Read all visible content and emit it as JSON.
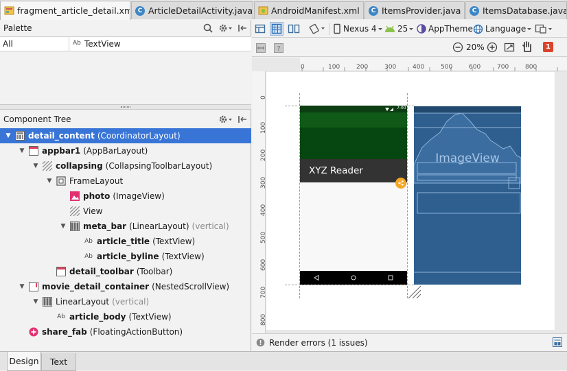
{
  "tabs": [
    {
      "label": "fragment_article_detail.xml",
      "icon": "xml-layout-icon",
      "active": true
    },
    {
      "label": "ArticleDetailActivity.java",
      "icon": "java-class-icon"
    },
    {
      "label": "AndroidManifest.xml",
      "icon": "android-manifest-icon"
    },
    {
      "label": "ItemsProvider.java",
      "icon": "java-class-icon"
    },
    {
      "label": "ItemsDatabase.java",
      "icon": "java-class-icon"
    }
  ],
  "class_badge": "C",
  "close_glyph": "×",
  "palette": {
    "title": "Palette",
    "filter_label": "All",
    "item_icon_text": "Ab",
    "item_label": "TextView"
  },
  "component_tree": {
    "title": "Component Tree",
    "rows": [
      {
        "name": "detail_content",
        "type": "(CoordinatorLayout)",
        "depth": 0,
        "expanded": true,
        "selected": true,
        "icon": "coordinator-layout-icon"
      },
      {
        "name": "appbar1",
        "type": "(AppBarLayout)",
        "depth": 1,
        "expanded": true,
        "icon": "appbar-layout-icon"
      },
      {
        "name": "collapsing",
        "type": "(CollapsingToolbarLayout)",
        "depth": 2,
        "expanded": true,
        "icon": "collapsing-toolbar-icon"
      },
      {
        "name": "FrameLayout",
        "type": "",
        "depth": 3,
        "expanded": true,
        "plain": true,
        "icon": "frame-layout-icon"
      },
      {
        "name": "photo",
        "type": "(ImageView)",
        "depth": 4,
        "icon": "image-view-icon"
      },
      {
        "name": "View",
        "type": "",
        "depth": 4,
        "plain": true,
        "icon": "view-icon"
      },
      {
        "name": "meta_bar",
        "type": "(LinearLayout)",
        "extra": "(vertical)",
        "depth": 4,
        "expanded": true,
        "icon": "linear-layout-icon"
      },
      {
        "name": "article_title",
        "type": "(TextView)",
        "depth": 5,
        "icon": "text-view-icon"
      },
      {
        "name": "article_byline",
        "type": "(TextView)",
        "depth": 5,
        "icon": "text-view-icon"
      },
      {
        "name": "detail_toolbar",
        "type": "(Toolbar)",
        "depth": 3,
        "icon": "toolbar-icon"
      },
      {
        "name": "movie_detail_container",
        "type": "(NestedScrollView)",
        "depth": 1,
        "expanded": true,
        "icon": "scroll-view-icon"
      },
      {
        "name": "LinearLayout",
        "type": "",
        "extra": "(vertical)",
        "depth": 2,
        "expanded": true,
        "plain": true,
        "icon": "linear-layout-icon"
      },
      {
        "name": "article_body",
        "type": "(TextView)",
        "depth": 3,
        "icon": "text-view-icon"
      },
      {
        "name": "share_fab",
        "type": "(FloatingActionButton)",
        "depth": 1,
        "icon": "fab-icon"
      }
    ]
  },
  "designer_toolbar": {
    "device": "Nexus 4",
    "api": "25",
    "theme": "AppTheme",
    "language": "Language",
    "zoom": "20%"
  },
  "ruler": {
    "top": [
      "0",
      "100",
      "200",
      "300",
      "400",
      "500",
      "600",
      "700",
      "800"
    ],
    "left": [
      "0",
      "100",
      "200",
      "300",
      "400",
      "500",
      "600",
      "700",
      "800"
    ]
  },
  "preview": {
    "app_title": "XYZ Reader",
    "status_time": "7:00",
    "blueprint_label": "ImageView"
  },
  "status": {
    "text": "Render errors (1 issues)",
    "error_count": "1"
  },
  "bottom_tabs": [
    {
      "label": "Design",
      "active": true
    },
    {
      "label": "Text"
    }
  ],
  "colors": {
    "selection": "#3875d7",
    "accent": "#f5a623",
    "primary_dark": "#0a4a12",
    "blueprint": "#2f5f8f",
    "status_icon": "#e2e2e2"
  }
}
